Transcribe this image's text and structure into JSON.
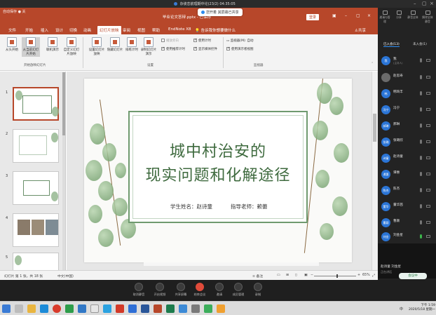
{
  "meeting": {
    "title": "杂诶恋航理期中论(23/2)",
    "timer": "04:35:05",
    "share_toast": "您开着 其屏幕已共享",
    "controls": [
      "取消静音",
      "开启视频",
      "共享屏幕",
      "结束会议",
      "邀请",
      "成员管理",
      "录制"
    ]
  },
  "ppt": {
    "quick_access": "自动保存 ● 关",
    "file_name": "毕业论文答辩.pptx - 已保存",
    "login_label": "登录",
    "share_label": "共享",
    "tabs": [
      "文件",
      "开始",
      "插入",
      "设计",
      "切换",
      "动画",
      "幻灯片放映",
      "审阅",
      "视图",
      "帮助",
      "EndNote X8",
      "告诉我你想要做什么"
    ],
    "active_tab": "幻灯片放映",
    "ribbon": {
      "buttons": [
        "从头开始",
        "从当前幻灯片开始",
        "联机演示",
        "自定义幻灯片放映",
        "设置幻灯片放映",
        "隐藏幻灯片",
        "排练计时",
        "录制幻灯片演示"
      ],
      "group_start": "开始放映幻灯片",
      "group_setup": "设置",
      "group_monitor": "监视器",
      "checks": {
        "play_narration": "播放旁白",
        "use_timings": "使用计时",
        "show_media_controls": "显示媒体控件",
        "recommended_timings": "使用推荐计时",
        "monitor": "监视器(M): 自动",
        "presenter_view": "使用演示者视图"
      }
    },
    "thumb_numbers": [
      "1",
      "2",
      "3",
      "4",
      "5"
    ],
    "slide": {
      "title_line1": "城中村治安的",
      "title_line2": "现实问题和化解途径",
      "student": "学生姓名：赵诗童",
      "teacher": "指导老师：赖蕾"
    },
    "status": {
      "slide_count": "幻灯片 第 1 张，共 18 张",
      "language": "中文(中国)",
      "notes": "备注",
      "zoom": "65%"
    }
  },
  "panel": {
    "top_icons": [
      "邀请与管理",
      "分享",
      "静音全体",
      "解除全体静音"
    ],
    "tabs": [
      "已入会(13)",
      "未入会(1)"
    ],
    "participants": [
      {
        "name": "我",
        "sub": "(主持人)",
        "avatar": "我"
      },
      {
        "name": "赵思寿",
        "sub": "",
        "avatar": ""
      },
      {
        "name": "韩琦丰",
        "sub": "",
        "avatar": "韩"
      },
      {
        "name": "冯宁",
        "sub": "",
        "avatar": "冯宁"
      },
      {
        "name": "郝琳",
        "sub": "",
        "avatar": "郝琳"
      },
      {
        "name": "张璐欣",
        "sub": "",
        "avatar": "张璐"
      },
      {
        "name": "赵诗童",
        "sub": "",
        "avatar": "诗童"
      },
      {
        "name": "谭惠",
        "sub": "",
        "avatar": "谭惠"
      },
      {
        "name": "陈杰",
        "sub": "",
        "avatar": "陈杰"
      },
      {
        "name": "董华茜",
        "sub": "",
        "avatar": "董华"
      },
      {
        "name": "曹颖",
        "sub": "",
        "avatar": "曹颖"
      },
      {
        "name": "刘金星",
        "sub": "",
        "avatar": "刘金"
      }
    ],
    "speaker": {
      "label": "赵诗童 刘金星",
      "sub": "正在讲话",
      "badge": "会议中"
    }
  },
  "taskbar": {
    "ime": "中",
    "time": "下午 1:59",
    "date": "2020/5/18 星期一"
  }
}
